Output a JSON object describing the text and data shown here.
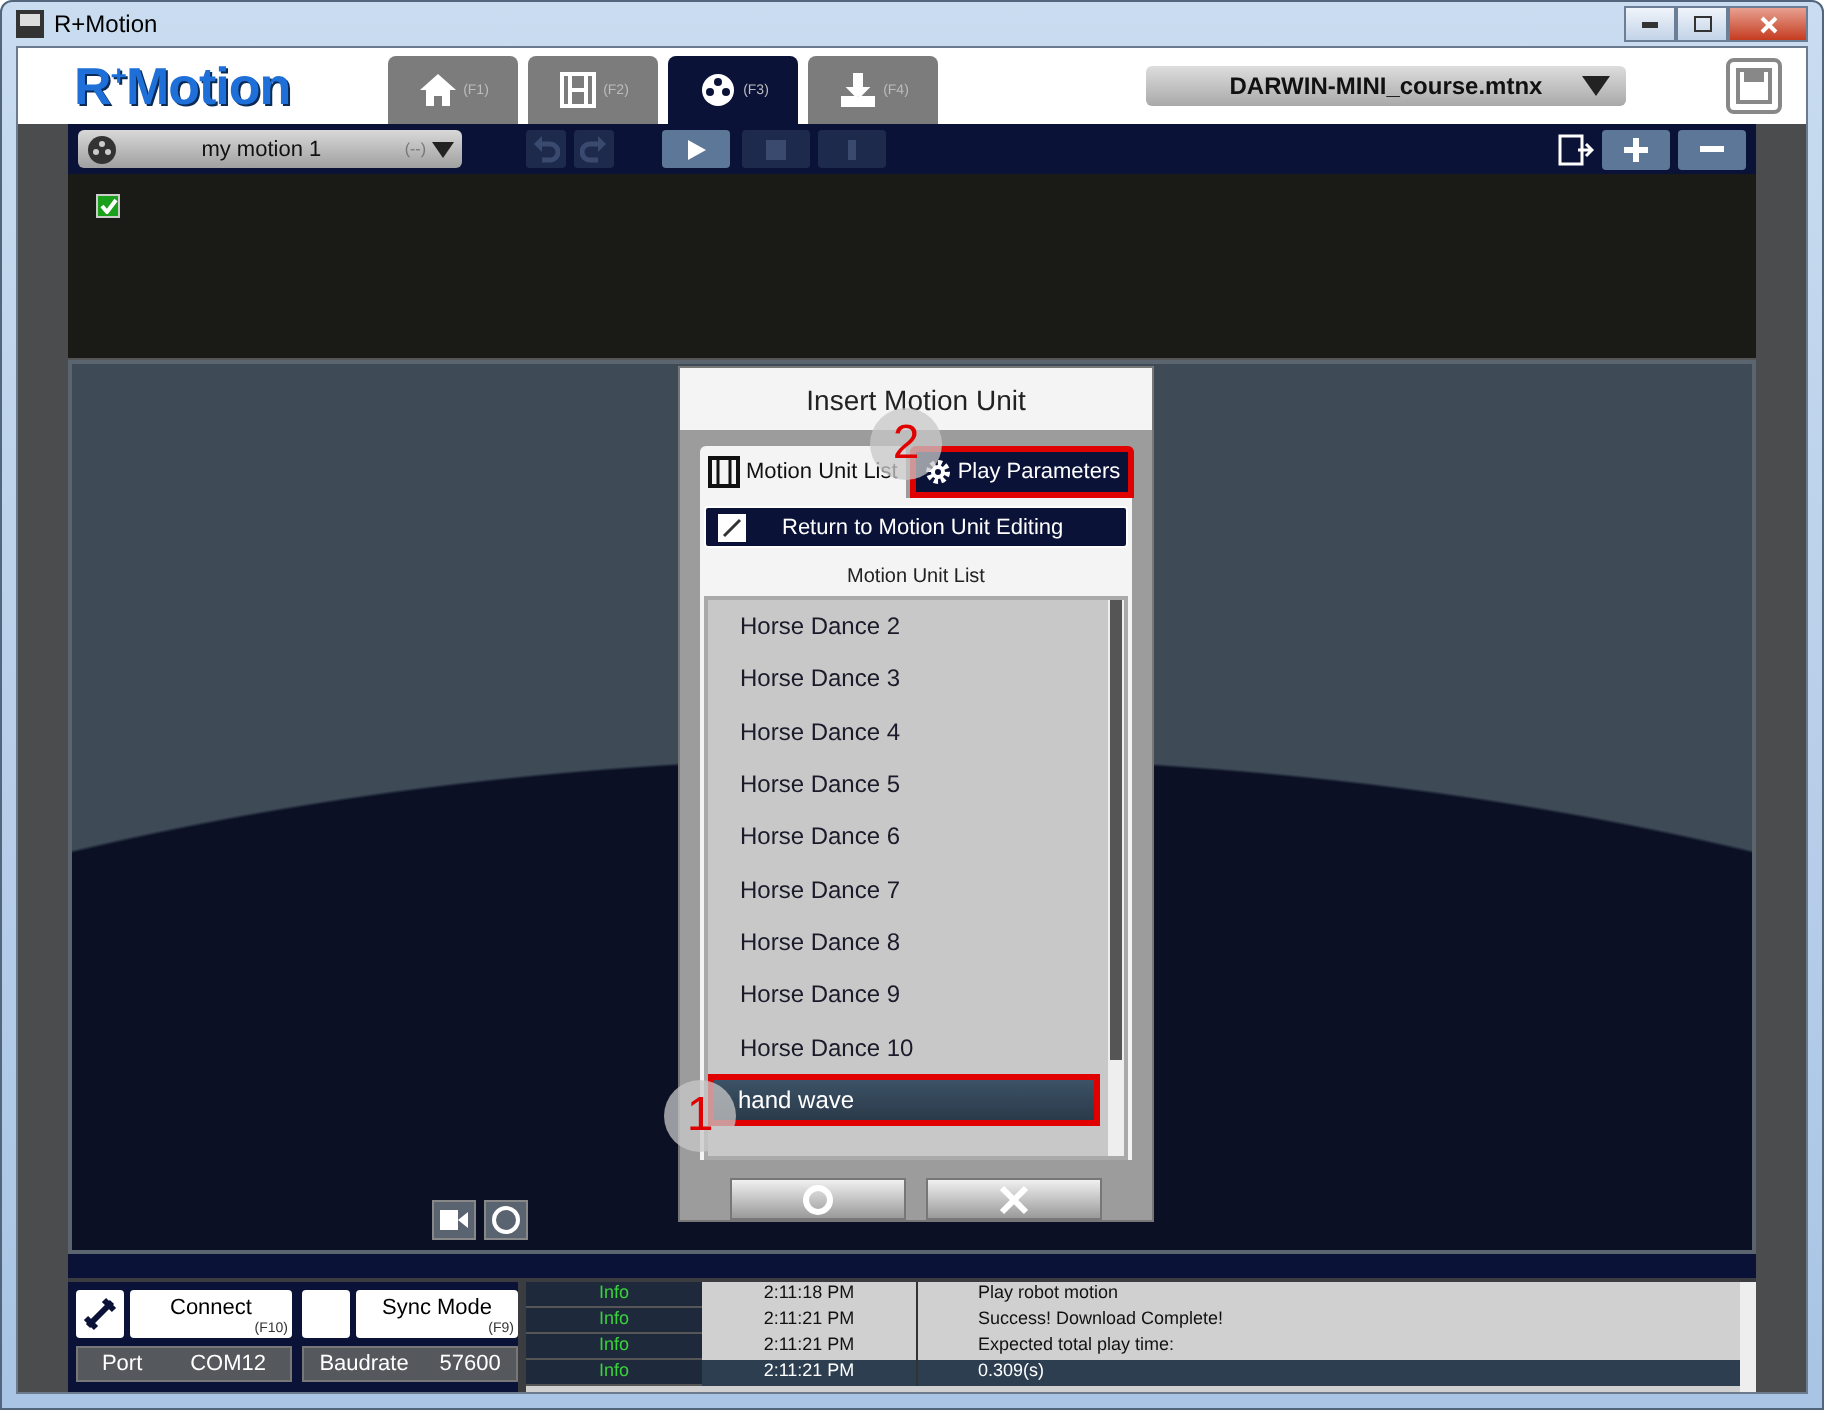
{
  "window": {
    "title": "R+Motion"
  },
  "logo": "R$^{+}$Motion",
  "tabs": [
    {
      "kind": "home",
      "key": "(F1)",
      "selected": false
    },
    {
      "kind": "film",
      "key": "(F2)",
      "selected": false
    },
    {
      "kind": "reel",
      "key": "(F3)",
      "selected": true
    },
    {
      "kind": "download",
      "key": "(F4)",
      "selected": false
    }
  ],
  "file_select": {
    "value": "DARWIN-MINI_course.mtnx"
  },
  "motion_select": {
    "value": "my motion 1",
    "hint": "(--)"
  },
  "playback": [
    {
      "kind": "undo",
      "disabled": true
    },
    {
      "kind": "redo",
      "disabled": true
    },
    {
      "kind": "play",
      "disabled": false
    },
    {
      "kind": "stop",
      "disabled": true
    },
    {
      "kind": "pause",
      "disabled": true
    }
  ],
  "timeline": {
    "checked": true
  },
  "dialog": {
    "title": "Insert Motion Unit",
    "tabs": [
      {
        "kind": "film",
        "label": "Motion Unit List",
        "selected": true,
        "highlighted": false
      },
      {
        "kind": "gear",
        "label": "Play Parameters",
        "selected": false,
        "highlighted": true
      }
    ],
    "return_button": "Return to Motion Unit Editing",
    "list_title": "Motion Unit List",
    "items": [
      {
        "label": "Horse Dance 2",
        "selected": false,
        "highlighted": false
      },
      {
        "label": "Horse Dance 3",
        "selected": false,
        "highlighted": false
      },
      {
        "label": "Horse Dance 4",
        "selected": false,
        "highlighted": false
      },
      {
        "label": "Horse Dance 5",
        "selected": false,
        "highlighted": false
      },
      {
        "label": "Horse Dance 6",
        "selected": false,
        "highlighted": false
      },
      {
        "label": "Horse Dance 7",
        "selected": false,
        "highlighted": false
      },
      {
        "label": "Horse Dance 8",
        "selected": false,
        "highlighted": false
      },
      {
        "label": "Horse Dance 9",
        "selected": false,
        "highlighted": false
      },
      {
        "label": "Horse Dance 10",
        "selected": false,
        "highlighted": false
      },
      {
        "label": "hand wave",
        "selected": true,
        "highlighted": true
      }
    ],
    "callouts": [
      "1",
      "2"
    ]
  },
  "connect": {
    "label": "Connect",
    "key": "(F10)"
  },
  "sync": {
    "label": "Sync Mode",
    "key": "(F9)"
  },
  "port": {
    "label": "Port",
    "value": "COM12"
  },
  "baudrate": {
    "label": "Baudrate",
    "value": "57600"
  },
  "log": [
    {
      "level": "Info",
      "time": "2:11:18 PM",
      "message": "Play robot motion",
      "selected": false
    },
    {
      "level": "Info",
      "time": "2:11:21 PM",
      "message": "Success! Download Complete!",
      "selected": false
    },
    {
      "level": "Info",
      "time": "2:11:21 PM",
      "message": "Expected total play time:",
      "selected": false
    },
    {
      "level": "Info",
      "time": "2:11:21 PM",
      "message": "0.309(s)",
      "selected": true
    }
  ]
}
